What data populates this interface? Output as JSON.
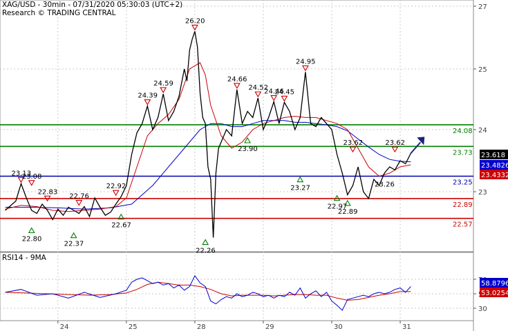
{
  "header": {
    "title": "XAG/USD - 30min - 07/31/2020 05:30:03 (UTC+2)",
    "subtitle": "Research © TRADING CENTRAL"
  },
  "rsi_panel": {
    "label": "RSI14 - 9MA"
  },
  "colors": {
    "price": "#000000",
    "fast_ma": "#cc0000",
    "slow_ma": "#0000cc",
    "resistance": "#008000",
    "pivot": "#0000aa",
    "support": "#cc0000",
    "panel_bg": "#ffffff",
    "grid": "#c8c8c8",
    "axis_text": "#404040",
    "target_arrow": "#1a237e"
  },
  "chart_data": [
    {
      "type": "line",
      "name": "price",
      "x_ticks": [
        {
          "label": "24",
          "t": 10
        },
        {
          "label": "25",
          "t": 23
        },
        {
          "label": "28",
          "t": 36
        },
        {
          "label": "29",
          "t": 49
        },
        {
          "label": "30",
          "t": 62
        },
        {
          "label": "31",
          "t": 75
        }
      ],
      "y_ticks": [
        "27",
        "25",
        "24",
        "23"
      ],
      "y_tick_values": [
        27,
        25,
        24,
        23
      ],
      "series": [
        {
          "name": "XAG/USD",
          "t": [
            0,
            2,
            3,
            4,
            5,
            6,
            7,
            8,
            9,
            10,
            11,
            12,
            13,
            14,
            15,
            16,
            17,
            18,
            19,
            20,
            21,
            22,
            23,
            24,
            25,
            26,
            27,
            28,
            29,
            30,
            31,
            32,
            33,
            34,
            34.5,
            35,
            35.5,
            36,
            36.5,
            37,
            37.5,
            38,
            38.5,
            39,
            39.5,
            40,
            40.5,
            41,
            42,
            43,
            44,
            45,
            46,
            47,
            48,
            49,
            50,
            51,
            52,
            53,
            54,
            55,
            56,
            57,
            58,
            59,
            60,
            61,
            62,
            63,
            64,
            65,
            66,
            67,
            68,
            69,
            70,
            71,
            72,
            73,
            74,
            75,
            76,
            77
          ],
          "values": [
            22.7,
            22.85,
            23.13,
            22.9,
            22.7,
            22.65,
            22.8,
            22.7,
            22.55,
            22.72,
            22.62,
            22.75,
            22.7,
            22.65,
            22.76,
            22.6,
            22.9,
            22.75,
            22.62,
            22.67,
            22.8,
            22.92,
            23.1,
            23.6,
            23.95,
            24.1,
            24.39,
            24.0,
            24.2,
            24.59,
            24.15,
            24.3,
            24.55,
            25.0,
            24.8,
            25.6,
            25.95,
            26.2,
            25.7,
            24.6,
            24.2,
            24.1,
            23.4,
            23.2,
            22.26,
            23.3,
            23.7,
            23.8,
            24.0,
            23.9,
            24.66,
            24.1,
            24.3,
            24.2,
            24.52,
            24.0,
            24.2,
            24.46,
            24.1,
            24.45,
            24.3,
            24.0,
            24.2,
            24.95,
            24.1,
            24.05,
            24.2,
            24.1,
            24.0,
            23.6,
            23.3,
            22.95,
            23.1,
            23.4,
            23.0,
            22.89,
            23.2,
            23.1,
            23.3,
            23.4,
            23.35,
            23.5,
            23.45,
            23.618
          ]
        }
      ],
      "ma_series": [
        {
          "name": "fast MA",
          "t": [
            0,
            3,
            6,
            9,
            12,
            15,
            18,
            21,
            23,
            25,
            27,
            29,
            31,
            33,
            35,
            37,
            38,
            39,
            41,
            43,
            45,
            47,
            49,
            51,
            53,
            55,
            57,
            59,
            61,
            63,
            65,
            67,
            69,
            71,
            73,
            75,
            77
          ],
          "values": [
            22.72,
            22.78,
            22.76,
            22.7,
            22.68,
            22.7,
            22.72,
            22.76,
            22.9,
            23.4,
            23.9,
            24.1,
            24.25,
            24.5,
            25.0,
            25.2,
            24.9,
            24.4,
            23.9,
            23.7,
            23.8,
            24.0,
            24.1,
            24.15,
            24.2,
            24.22,
            24.2,
            24.2,
            24.15,
            24.1,
            24.0,
            23.7,
            23.4,
            23.25,
            23.3,
            23.4,
            23.4332
          ]
        },
        {
          "name": "slow MA",
          "t": [
            0,
            5,
            10,
            15,
            20,
            24,
            28,
            32,
            35,
            37,
            39,
            41,
            43,
            45,
            47,
            49,
            51,
            53,
            55,
            57,
            59,
            61,
            63,
            65,
            67,
            69,
            71,
            73,
            75,
            77
          ],
          "values": [
            22.75,
            22.75,
            22.74,
            22.72,
            22.74,
            22.8,
            23.1,
            23.5,
            23.8,
            24.0,
            24.1,
            24.1,
            24.05,
            24.05,
            24.1,
            24.15,
            24.15,
            24.15,
            24.12,
            24.12,
            24.1,
            24.08,
            24.05,
            23.98,
            23.85,
            23.72,
            23.6,
            23.52,
            23.49,
            23.4826
          ]
        }
      ],
      "levels": [
        {
          "label": "24.08",
          "value": 24.08,
          "kind": "resistance"
        },
        {
          "label": "23.73",
          "value": 23.73,
          "kind": "resistance"
        },
        {
          "label": "23.25",
          "value": 23.25,
          "kind": "pivot"
        },
        {
          "label": "22.89",
          "value": 22.89,
          "kind": "support"
        },
        {
          "label": "22.57",
          "value": 22.57,
          "kind": "support"
        }
      ],
      "price_tags": [
        {
          "label": "23.618",
          "value": 23.618,
          "kind": "last"
        },
        {
          "label": "23.4826",
          "value": 23.4826,
          "kind": "slow"
        },
        {
          "label": "23.4332",
          "value": 23.4332,
          "kind": "fast"
        }
      ],
      "markers": [
        {
          "label": "23.13",
          "t": 3,
          "value": 23.13,
          "dir": "down"
        },
        {
          "label": "23.08",
          "t": 5,
          "value": 23.08,
          "dir": "down"
        },
        {
          "label": "22.83",
          "t": 8,
          "value": 22.83,
          "dir": "down"
        },
        {
          "label": "22.76",
          "t": 14,
          "value": 22.76,
          "dir": "down"
        },
        {
          "label": "22.92",
          "t": 21,
          "value": 22.92,
          "dir": "down"
        },
        {
          "label": "24.39",
          "t": 27,
          "value": 24.39,
          "dir": "down"
        },
        {
          "label": "24.59",
          "t": 30,
          "value": 24.59,
          "dir": "down"
        },
        {
          "label": "26.20",
          "t": 36,
          "value": 26.2,
          "dir": "down"
        },
        {
          "label": "24.66",
          "t": 44,
          "value": 24.66,
          "dir": "down"
        },
        {
          "label": "24.52",
          "t": 48,
          "value": 24.52,
          "dir": "down"
        },
        {
          "label": "24.46",
          "t": 51,
          "value": 24.46,
          "dir": "down"
        },
        {
          "label": "24.45",
          "t": 53,
          "value": 24.45,
          "dir": "down"
        },
        {
          "label": "24.95",
          "t": 57,
          "value": 24.95,
          "dir": "down"
        },
        {
          "label": "23.62",
          "t": 66,
          "value": 23.62,
          "dir": "down"
        },
        {
          "label": "23.62",
          "t": 74,
          "value": 23.62,
          "dir": "down"
        },
        {
          "label": "22.80",
          "t": 5,
          "value": 22.45,
          "dir": "up"
        },
        {
          "label": "22.37",
          "t": 13,
          "value": 22.37,
          "dir": "up"
        },
        {
          "label": "22.67",
          "t": 22,
          "value": 22.67,
          "dir": "up"
        },
        {
          "label": "22.26",
          "t": 38,
          "value": 22.26,
          "dir": "up"
        },
        {
          "label": "23.90",
          "t": 46,
          "value": 23.9,
          "dir": "up"
        },
        {
          "label": "23.27",
          "t": 56,
          "value": 23.27,
          "dir": "up"
        },
        {
          "label": "22.97",
          "t": 63,
          "value": 22.97,
          "dir": "up"
        },
        {
          "label": "22.89",
          "t": 65,
          "value": 22.89,
          "dir": "up"
        },
        {
          "label": "23.26",
          "t": 72,
          "value": 23.26,
          "dir": "none"
        }
      ]
    },
    {
      "type": "line",
      "name": "RSI14 - 9MA",
      "y_ticks": [
        "70",
        "50",
        "30"
      ],
      "y_tick_values": [
        70,
        50,
        30
      ],
      "series": [
        {
          "name": "RSI14",
          "t": [
            0,
            3,
            6,
            9,
            12,
            15,
            18,
            21,
            23,
            24,
            25,
            26,
            27,
            28,
            29,
            30,
            31,
            32,
            33,
            34,
            35,
            36,
            37,
            38,
            39,
            40,
            41,
            42,
            43,
            44,
            45,
            46,
            47,
            48,
            49,
            50,
            51,
            52,
            53,
            54,
            55,
            56,
            57,
            58,
            59,
            60,
            61,
            62,
            63,
            64,
            65,
            66,
            67,
            68,
            69,
            70,
            71,
            72,
            73,
            74,
            75,
            76,
            77
          ],
          "values": [
            52,
            56,
            48,
            50,
            44,
            52,
            45,
            50,
            55,
            66,
            70,
            72,
            68,
            64,
            66,
            62,
            64,
            58,
            62,
            55,
            60,
            75,
            65,
            60,
            40,
            36,
            42,
            46,
            44,
            50,
            46,
            48,
            52,
            50,
            46,
            48,
            44,
            48,
            46,
            52,
            48,
            58,
            44,
            50,
            54,
            46,
            52,
            40,
            34,
            27,
            42,
            44,
            46,
            48,
            46,
            50,
            52,
            50,
            52,
            56,
            58,
            52,
            60
          ]
        },
        {
          "name": "9MA",
          "t": [
            0,
            4,
            8,
            12,
            16,
            20,
            23,
            25,
            27,
            29,
            31,
            33,
            35,
            37,
            39,
            41,
            43,
            45,
            47,
            49,
            51,
            53,
            55,
            57,
            59,
            61,
            63,
            65,
            67,
            69,
            71,
            73,
            75,
            77
          ],
          "values": [
            52,
            51,
            50,
            49,
            48,
            49,
            51,
            56,
            63,
            66,
            64,
            62,
            62,
            60,
            56,
            50,
            47,
            48,
            48,
            48,
            47,
            48,
            49,
            49,
            48,
            48,
            44,
            41,
            42,
            45,
            48,
            50,
            53,
            53
          ]
        }
      ],
      "price_tags": [
        {
          "label": "58.8796",
          "value": 58.8796,
          "kind": "rsi"
        },
        {
          "label": "53.0254",
          "value": 53.0254,
          "kind": "ma"
        }
      ]
    }
  ]
}
